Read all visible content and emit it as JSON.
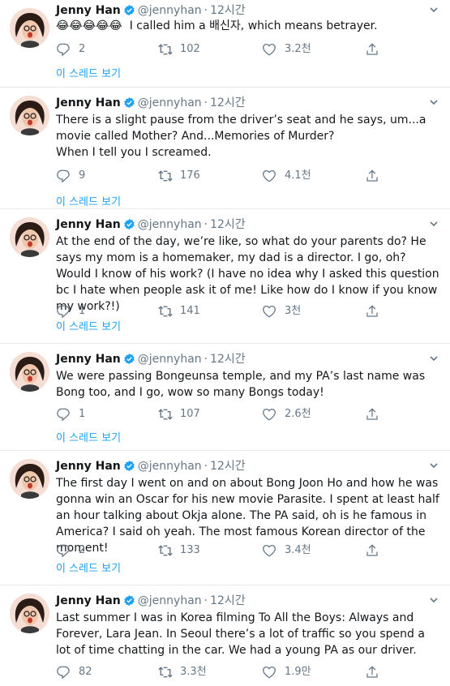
{
  "tweets": [
    {
      "name": "Jenny Han",
      "handle": "@jennyhan",
      "separator": "·",
      "time": "12시간",
      "text": "😂😂😂😂😂  I called him a 배신자, which means betrayer.",
      "reply": "2",
      "retweet": "102",
      "like": "3.2천",
      "thread": "이 스레드 보기"
    },
    {
      "name": "Jenny Han",
      "handle": "@jennyhan",
      "separator": "·",
      "time": "12시간",
      "text": "There is a slight pause from the driver’s seat and he says, um...a movie called Mother? And...Memories of Murder?\nWhen I tell you I screamed.",
      "reply": "9",
      "retweet": "176",
      "like": "4.1천",
      "thread": "이 스레드 보기"
    },
    {
      "name": "Jenny Han",
      "handle": "@jennyhan",
      "separator": "·",
      "time": "12시간",
      "text": "At the end of the day, we’re like, so what do your parents do? He says my mom is a homemaker, my dad is a director. I go, oh? Would I know of his work? (I have no idea why I asked this question bc I hate when people ask it of me! Like how do I know if you know my work?!)",
      "reply": "1",
      "retweet": "141",
      "like": "3천",
      "thread": "이 스레드 보기"
    },
    {
      "name": "Jenny Han",
      "handle": "@jennyhan",
      "separator": "·",
      "time": "12시간",
      "text": "We were passing Bongeunsa temple, and my PA’s last name was Bong too, and I go, wow so many Bongs today!",
      "reply": "1",
      "retweet": "107",
      "like": "2.6천",
      "thread": "이 스레드 보기"
    },
    {
      "name": "Jenny Han",
      "handle": "@jennyhan",
      "separator": "·",
      "time": "12시간",
      "text": "The first day I went on and on about Bong Joon Ho and how he was gonna win an Oscar for his new movie Parasite. I spent at least half an hour talking about Okja alone. The PA said, oh is he famous in America? I said oh yeah. The most famous Korean director of the moment!",
      "reply": "2",
      "retweet": "133",
      "like": "3.4천",
      "thread": "이 스레드 보기"
    },
    {
      "name": "Jenny Han",
      "handle": "@jennyhan",
      "separator": "·",
      "time": "12시간",
      "text": "Last summer I was in Korea filming To All the Boys: Always and Forever, Lara Jean. In Seoul there’s a lot of traffic so you spend a lot of time chatting in the car. We had a young PA as our driver.",
      "reply": "82",
      "retweet": "3.3천",
      "like": "1.9만",
      "thread": ""
    }
  ],
  "colors": {
    "text": "#14171a",
    "muted": "#657786",
    "link": "#1da1f2",
    "divider": "#e6ecf0",
    "verified": "#1da1f2"
  },
  "icons": {
    "reply": "reply-icon",
    "retweet": "retweet-icon",
    "like": "heart-icon",
    "share": "share-icon",
    "verified": "verified-badge-icon",
    "menu": "chevron-down-icon"
  }
}
